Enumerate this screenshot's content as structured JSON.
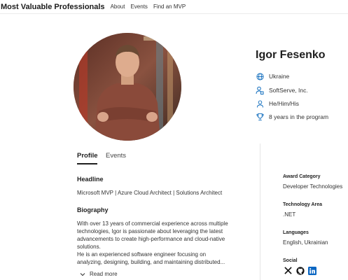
{
  "header": {
    "brand": "Most Valuable Professionals",
    "nav": [
      "About",
      "Events",
      "Find an MVP"
    ]
  },
  "profile": {
    "name": "Igor Fesenko",
    "info": [
      {
        "icon": "globe-icon",
        "text": "Ukraine"
      },
      {
        "icon": "building-person-icon",
        "text": "SoftServe, Inc."
      },
      {
        "icon": "person-icon",
        "text": "He/Him/His"
      },
      {
        "icon": "trophy-icon",
        "text": "8 years in the program"
      }
    ]
  },
  "tabs": {
    "profile": "Profile",
    "events": "Events"
  },
  "main": {
    "headline_title": "Headline",
    "headline": "Microsoft MVP | Azure Cloud Architect | Solutions Architect",
    "biography_title": "Biography",
    "biography_lines": [
      "With over 13 years of commercial experience across multiple",
      "technologies, Igor is passionate about leveraging the latest",
      "advancements to create high-performance and cloud-native",
      "solutions.",
      "He is an experienced software engineer focusing on",
      "analyzing, designing, building, and maintaining distributed..."
    ],
    "read_more": "Read more"
  },
  "sidebar": {
    "award_category_label": "Award Category",
    "award_category": "Developer Technologies",
    "technology_area_label": "Technology Area",
    "technology_area": ".NET",
    "languages_label": "Languages",
    "languages": "English, Ukrainian",
    "social_label": "Social",
    "social_icons": [
      "x-icon",
      "github-icon",
      "linkedin-icon"
    ]
  },
  "colors": {
    "icon_blue": "#0f6cbd",
    "linkedin": "#0a66c2",
    "text": "#242424"
  }
}
